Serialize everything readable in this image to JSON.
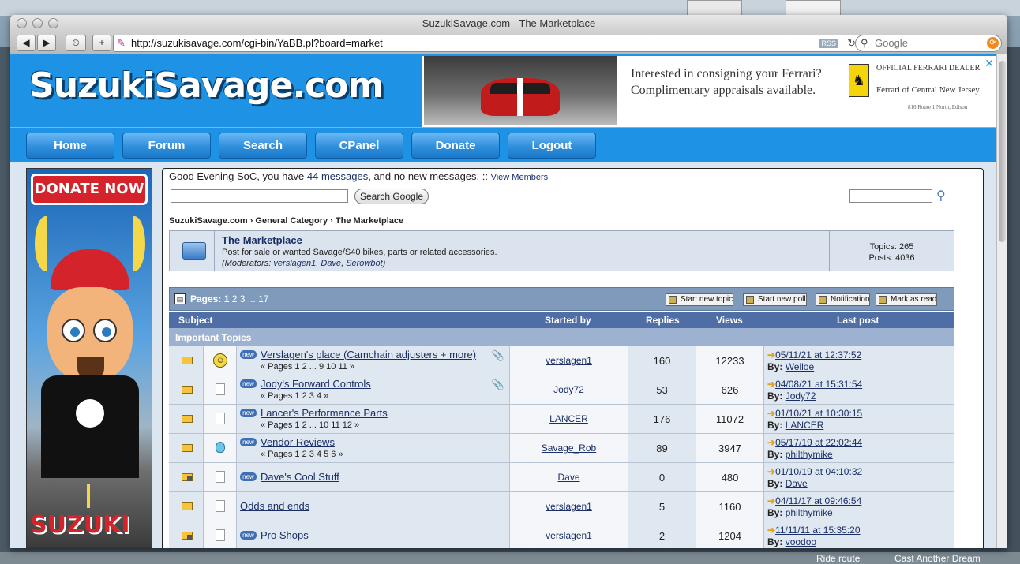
{
  "desktop": {
    "bottom_labels": [
      "Ride route",
      "Cast Another Dream"
    ]
  },
  "browser": {
    "title": "SuzukiSavage.com - The Marketplace",
    "url": "http://suzukisavage.com/cgi-bin/YaBB.pl?board=market",
    "rss_label": "RSS",
    "search_placeholder": "Google",
    "back_icon": "◀",
    "forward_icon": "▶",
    "history_icon": "⏲",
    "add_icon": "+"
  },
  "site": {
    "logo": "SuzukiSavage.com",
    "ad": {
      "line1": "Interested in consigning your Ferrari?",
      "line2": "Complimentary appraisals available.",
      "dealer1": "OFFICIAL FERRARI DEALER",
      "dealer2": "Ferrari of Central New Jersey",
      "dealer3": "816 Route 1 North, Edison",
      "close": "✕"
    },
    "nav": [
      "Home",
      "Forum",
      "Search",
      "CPanel",
      "Donate",
      "Logout"
    ]
  },
  "banner": {
    "donate": "DONATE NOW",
    "brand": "SUZUKI"
  },
  "forum": {
    "greeting_prefix": "Good Evening SoC, you have ",
    "messages_link": "44 messages",
    "greeting_suffix": ", and no new messages. :: ",
    "view_members": "View Members",
    "search_google": "Search Google",
    "breadcrumb": "SuzukiSavage.com › General Category › The Marketplace",
    "board": {
      "title": "The Marketplace",
      "description": "Post for sale or wanted Savage/S40 bikes, parts or related accessories.",
      "mods_prefix": "(Moderators: ",
      "mods": [
        "verslagen1",
        "Dave",
        "Serowbot"
      ],
      "mods_suffix": ")",
      "topics": "Topics: 265",
      "posts": "Posts: 4036"
    },
    "pages_label": "Pages:",
    "pages_current": "1",
    "pages_links": "2 3 ... 17",
    "actions": [
      "Start new topic",
      "Start new poll",
      "Notification",
      "Mark as read"
    ],
    "columns": [
      "Subject",
      "Started by",
      "Replies",
      "Views",
      "Last post"
    ],
    "section": "Important Topics",
    "new_badge": "new",
    "by_label": "By:",
    "topics": [
      {
        "subject": "Verslagen's place (Camchain adjusters + more)",
        "pages": "« Pages 1 2 ... 9 10 11 »",
        "started_by": "verslagen1",
        "replies": "160",
        "views": "12233",
        "last_date": "05/11/21 at 12:37:52",
        "last_by": "Welloe",
        "icon": "smile",
        "clip": true,
        "is_new": true
      },
      {
        "subject": "Jody's Forward Controls",
        "pages": "« Pages 1 2 3 4 »",
        "started_by": "Jody72",
        "replies": "53",
        "views": "626",
        "last_date": "04/08/21 at 15:31:54",
        "last_by": "Jody72",
        "icon": "doc",
        "clip": true,
        "is_new": true
      },
      {
        "subject": "Lancer's Performance Parts",
        "pages": "« Pages 1 2 ... 10 11 12 »",
        "started_by": "LANCER",
        "replies": "176",
        "views": "11072",
        "last_date": "01/10/21 at 10:30:15",
        "last_by": "LANCER",
        "icon": "doc",
        "clip": false,
        "is_new": true
      },
      {
        "subject": "Vendor Reviews",
        "pages": "« Pages 1 2 3 4 5 6 »",
        "started_by": "Savage_Rob",
        "replies": "89",
        "views": "3947",
        "last_date": "05/17/19 at 22:02:44",
        "last_by": "philthymike",
        "icon": "bulb",
        "clip": false,
        "is_new": true
      },
      {
        "subject": "Dave's Cool Stuff",
        "pages": "",
        "started_by": "Dave",
        "replies": "0",
        "views": "480",
        "last_date": "01/10/19 at 04:10:32",
        "last_by": "Dave",
        "icon": "doc",
        "clip": false,
        "is_new": true,
        "locked": true
      },
      {
        "subject": "Odds and ends",
        "pages": "",
        "started_by": "verslagen1",
        "replies": "5",
        "views": "1160",
        "last_date": "04/11/17 at 09:46:54",
        "last_by": "philthymike",
        "icon": "doc",
        "clip": false,
        "is_new": false
      },
      {
        "subject": "Pro Shops",
        "pages": "",
        "started_by": "verslagen1",
        "replies": "2",
        "views": "1204",
        "last_date": "11/11/11 at 15:35:20",
        "last_by": "voodoo",
        "icon": "doc",
        "clip": false,
        "is_new": true,
        "locked": true
      }
    ]
  }
}
